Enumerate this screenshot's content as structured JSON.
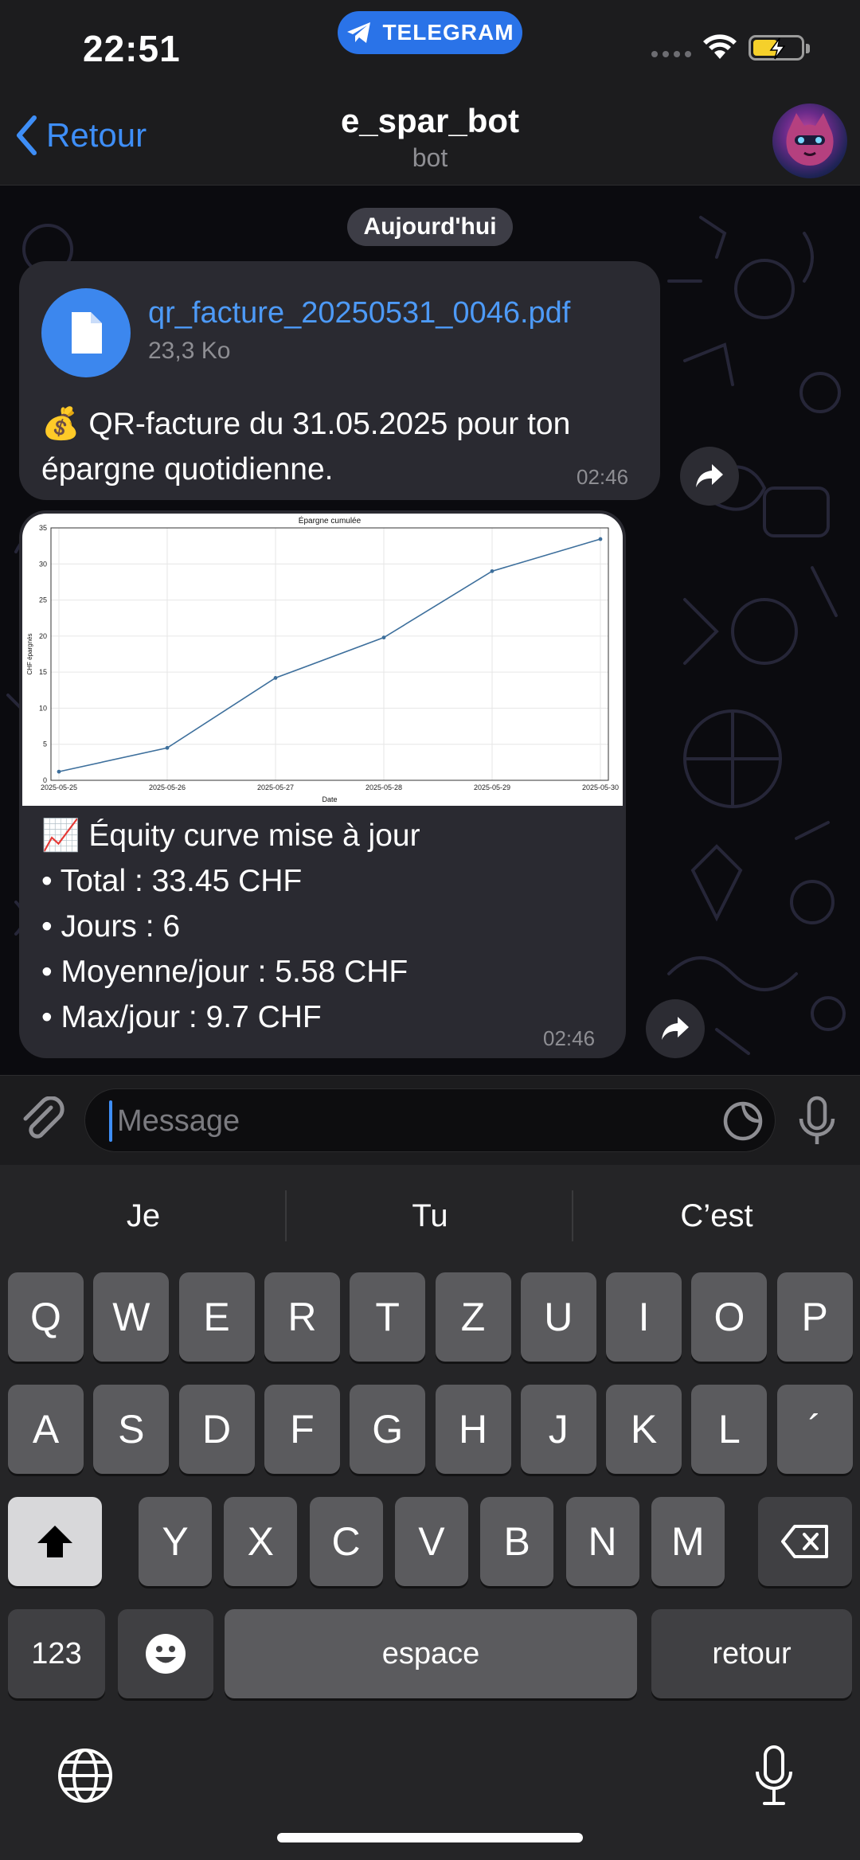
{
  "status_bar": {
    "time": "22:51",
    "telegram_label": "TELEGRAM"
  },
  "nav": {
    "back_label": "Retour",
    "title": "e_spar_bot",
    "subtitle": "bot"
  },
  "chat": {
    "date_label": "Aujourd'hui",
    "messages": [
      {
        "file_name": "qr_facture_20250531_0046.pdf",
        "file_size": "23,3 Ko",
        "emoji": "💰",
        "text_line1": "QR-facture du 31.05.2025 pour ton",
        "text_line2": "épargne quotidienne.",
        "time": "02:46"
      },
      {
        "emoji": "📈",
        "line1": "Équity curve mise à jour",
        "line2": "• Total : 33.45 CHF",
        "line3": "• Jours : 6",
        "line4": "• Moyenne/jour : 5.58 CHF",
        "line5": "• Max/jour : 9.7 CHF",
        "time": "02:46"
      }
    ]
  },
  "chart_data": {
    "type": "line",
    "title": "Épargne cumulée",
    "xlabel": "Date",
    "ylabel": "CHF épargnés",
    "x": [
      "2025-05-25",
      "2025-05-26",
      "2025-05-27",
      "2025-05-28",
      "2025-05-29",
      "2025-05-30"
    ],
    "y": [
      1.2,
      4.5,
      14.2,
      19.8,
      29.0,
      33.45
    ],
    "ylim": [
      0,
      35
    ],
    "yticks": [
      0,
      5,
      10,
      15,
      20,
      25,
      30,
      35
    ],
    "grid": true,
    "line_color": "#3d6f9c"
  },
  "input": {
    "placeholder": "Message"
  },
  "keyboard": {
    "suggestions": [
      "Je",
      "Tu",
      "C’est"
    ],
    "row1": [
      "Q",
      "W",
      "E",
      "R",
      "T",
      "Z",
      "U",
      "I",
      "O",
      "P"
    ],
    "row2": [
      "A",
      "S",
      "D",
      "F",
      "G",
      "H",
      "J",
      "K",
      "L",
      "´"
    ],
    "row3": [
      "Y",
      "X",
      "C",
      "V",
      "B",
      "N",
      "M"
    ],
    "numbers_label": "123",
    "space_label": "espace",
    "return_label": "retour"
  },
  "colors": {
    "accent": "#3e8ef7",
    "bubble": "#2a2a31",
    "telegram_pill": "#2a73e8"
  }
}
